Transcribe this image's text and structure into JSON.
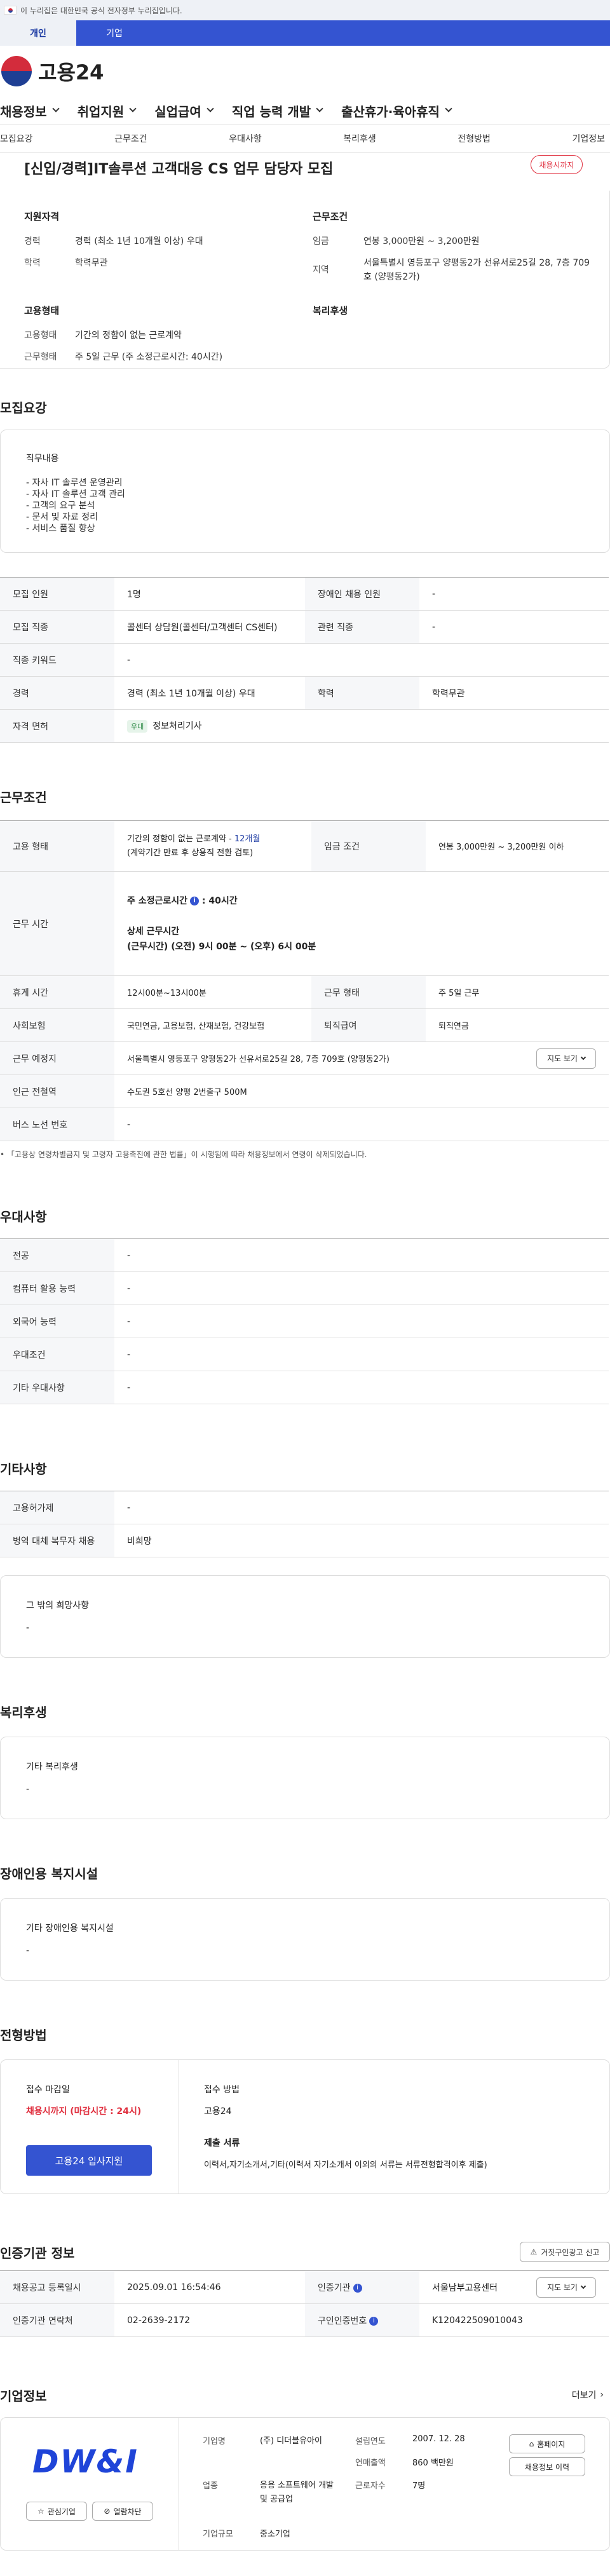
{
  "gov_banner": {
    "text": "이 누리집은 대한민국 공식 전자정부 누리집입니다."
  },
  "user_tabs": [
    "개인",
    "기업"
  ],
  "logo": {
    "text": "고용24"
  },
  "gnb": [
    "채용정보",
    "취업지원",
    "실업급여",
    "직업 능력 개발",
    "출산휴가·육아휴직"
  ],
  "subtabs": [
    "모집요강",
    "근무조건",
    "우대사항",
    "복리후생",
    "전형방법",
    "기업정보"
  ],
  "job": {
    "title": "[신입/경력]IT솔루션 고객대응 CS 업무 담당자 모집",
    "deadline_badge": "채용시까지"
  },
  "summary": {
    "qualification_title": "지원자격",
    "career_label": "경력",
    "career_value": "경력 (최소 1년 10개월 이상) 우대",
    "education_label": "학력",
    "education_value": "학력무관",
    "conditions_title": "근무조건",
    "wage_label": "임금",
    "wage_value": "연봉 3,000만원 ~ 3,200만원",
    "region_label": "지역",
    "region_value": "서울특별시 영등포구 양평동2가 선유서로25길 28, 7층 709호 (양평동2가)",
    "employment_title": "고용형태",
    "emp_type_label": "고용형태",
    "emp_type_value": "기간의 정함이 없는 근로계약",
    "work_type_label": "근무형태",
    "work_type_value": "주 5일 근무 (주 소정근로시간: 40시간)",
    "welfare_title": "복리후생"
  },
  "recruit": {
    "section_title": "모집요강",
    "duty_title": "직무내용",
    "duties": [
      "- 자사 IT 솔루션 운영관리",
      "- 자사 IT 솔루션 고객 관리",
      "- 고객의 요구 분석",
      "- 문서 및 자료 정리",
      "- 서비스 품질 향상"
    ],
    "table": {
      "headcount_label": "모집 인원",
      "headcount_value": "1명",
      "disabled_label": "장애인 채용 인원",
      "disabled_value": "-",
      "job_label": "모집 직종",
      "job_value": "콜센터 상담원(콜센터/고객센터 CS센터)",
      "related_label": "관련 직종",
      "related_value": "-",
      "keyword_label": "직종 키워드",
      "keyword_value": "-",
      "career_label": "경력",
      "career_value": "경력 (최소 1년 10개월 이상) 우대",
      "edu_label": "학력",
      "edu_value": "학력무관",
      "license_label": "자격 면허",
      "license_tag": "우대",
      "license_value": "정보처리기사"
    }
  },
  "work": {
    "section_title": "근무조건",
    "emp_label": "고용 형태",
    "emp_value_1": "기간의 정함이 없는 근로계약 - ",
    "emp_value_months": "12개월",
    "emp_value_2": "(계약기간 만료 후 상용직 전환 검토)",
    "wage_label": "임금 조건",
    "wage_value": "연봉 3,000만원 ~ 3,200만원 이하",
    "hours_label": "근무 시간",
    "hours_main_label": "주 소정근로시간",
    "hours_main_value": ": 40시간",
    "hours_detail_title": "상세 근무시간",
    "hours_detail_value": "(근무시간) (오전) 9시 00분 ~ (오후) 6시 00분",
    "break_label": "휴게 시간",
    "break_value": "12시00분~13시00분",
    "worktype_label": "근무 형태",
    "worktype_value": "주 5일 근무",
    "insurance_label": "사회보험",
    "insurance_value": "국민연금, 고용보험, 산재보험, 건강보험",
    "retire_label": "퇴직급여",
    "retire_value": "퇴직연금",
    "place_label": "근무 예정지",
    "place_value": "서울특별시 영등포구 양평동2가 선유서로25길 28, 7층 709호 (양평동2가)",
    "map_button": "지도 보기",
    "subway_label": "인근 전철역",
    "subway_value": "수도권 5호선 양평 2번출구 500M",
    "bus_label": "버스 노선 번호",
    "bus_value": "-",
    "note": "「고용상 연령차별금지 및 고령자 고용촉진에 관한 법률」이 시행됨에 따라 채용정보에서 연령이 삭제되었습니다."
  },
  "pref": {
    "section_title": "우대사항",
    "rows": [
      {
        "label": "전공",
        "value": "-"
      },
      {
        "label": "컴퓨터 활용 능력",
        "value": "-"
      },
      {
        "label": "외국어 능력",
        "value": "-"
      },
      {
        "label": "우대조건",
        "value": "-"
      },
      {
        "label": "기타 우대사항",
        "value": "-"
      }
    ]
  },
  "other": {
    "section_title": "기타사항",
    "rows": [
      {
        "label": "고용허가제",
        "value": "-"
      },
      {
        "label": "병역 대체 복무자 채용",
        "value": "비희망"
      }
    ],
    "wish_title": "그 밖의 희망사항",
    "wish_value": "-"
  },
  "welfare": {
    "section_title": "복리후생",
    "box_title": "기타 복리후생",
    "box_value": "-"
  },
  "facility": {
    "section_title": "장애인용 복지시설",
    "box_title": "기타 장애인용 복지시설",
    "box_value": "-"
  },
  "selection": {
    "section_title": "전형방법",
    "deadline_title": "접수 마감일",
    "deadline_value": "채용시까지 (마감시간 : 24시)",
    "apply_button": "고용24 입사지원",
    "method_title": "접수 방법",
    "method_value": "고용24",
    "docs_title": "제출 서류",
    "docs_value": "이력서,자기소개서,기타(이력서 자기소개서 이외의 서류는 서류전형합격이후 제출)"
  },
  "cert": {
    "section_title": "인증기관 정보",
    "report_button": "거짓구인광고 신고",
    "reg_label": "채용공고 등록일시",
    "reg_value": "2025.09.01 16:54:46",
    "agency_label": "인증기관",
    "agency_value": "서울남부고용센터",
    "map_button": "지도 보기",
    "contact_label": "인증기관 연락처",
    "contact_value": "02-2639-2172",
    "certno_label": "구인인증번호",
    "certno_value": "K120422509010043"
  },
  "company": {
    "section_title": "기업정보",
    "more": "더보기",
    "logo_text": "DW&I",
    "interest_button": "관심기업",
    "block_button": "열람차단",
    "name_label": "기업명",
    "name_value": "(주) 디더블유아이",
    "industry_label": "업종",
    "industry_value": "응용 소프트웨어 개발 및 공급업",
    "size_label": "기업규모",
    "size_value": "중소기업",
    "founded_label": "설립연도",
    "founded_value": "2007. 12. 28",
    "sales_label": "연매출액",
    "sales_value": "860 백만원",
    "staff_label": "근로자수",
    "staff_value": "7명",
    "homepage_button": "홈페이지",
    "jobs_button": "채용정보 이력"
  }
}
